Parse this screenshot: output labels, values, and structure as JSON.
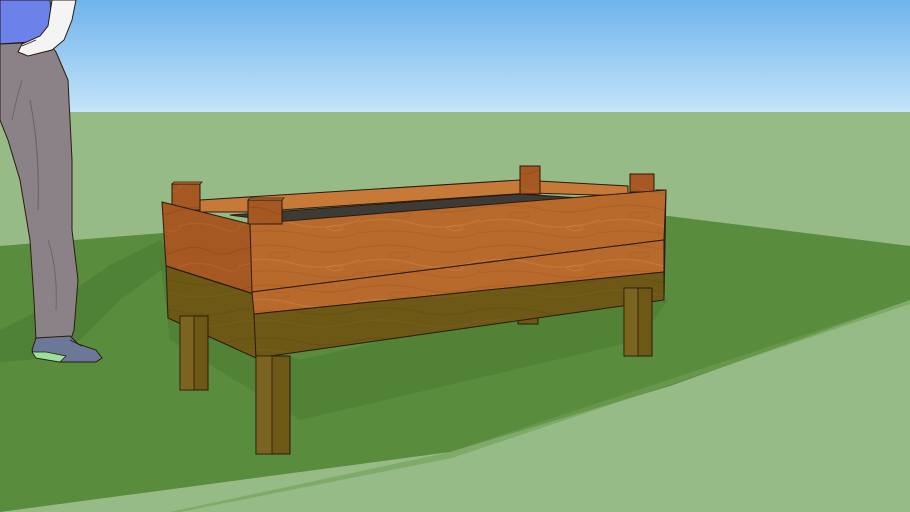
{
  "scene": {
    "colors": {
      "sky_top": "#6fb3ec",
      "sky_bottom": "#c4e4f8",
      "ground_light": "#96bb86",
      "ground_shade": "#598c3c",
      "wood_front": "#b86a2c",
      "wood_side": "#9a5020",
      "wood_top": "#c77a38",
      "wood_shaded": "#6e5816",
      "soil": "#3e3a36",
      "figure_shirt": "#6c82ea",
      "figure_pants": "#8b8287",
      "figure_shoe": "#6c7898",
      "figure_sole": "#9ce09a",
      "outline": "#2a1a0e"
    },
    "objects": [
      "raised-garden-planter",
      "human-scale-figure",
      "ground-plane",
      "ground-shadow",
      "sky"
    ]
  }
}
